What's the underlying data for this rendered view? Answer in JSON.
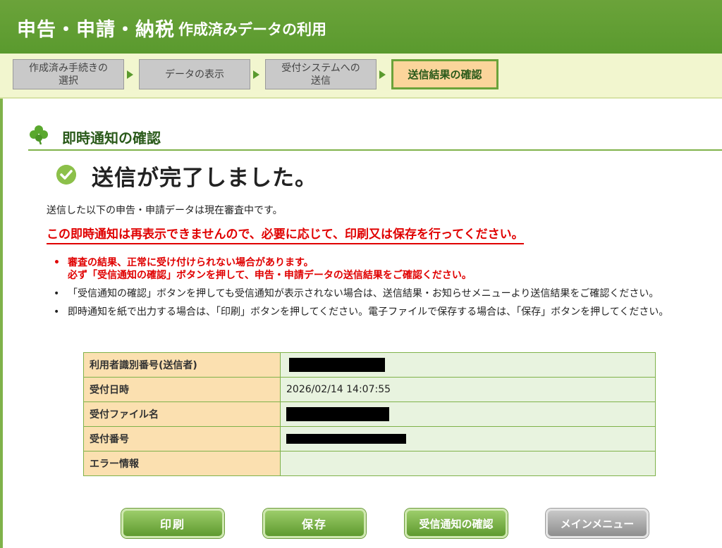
{
  "header": {
    "title": "申告・申請・納税",
    "subtitle": "作成済みデータの利用"
  },
  "steps": [
    {
      "label_line1": "作成済み手続きの",
      "label_line2": "選択",
      "active": false
    },
    {
      "label_line1": "データの表示",
      "label_line2": "",
      "active": false
    },
    {
      "label_line1": "受付システムへの",
      "label_line2": "送信",
      "active": false
    },
    {
      "label_line1": "送信結果の確認",
      "label_line2": "",
      "active": true
    }
  ],
  "section": {
    "title": "即時通知の確認"
  },
  "result": {
    "title": "送信が完了しました。",
    "description": "送信した以下の申告・申請データは現在審査中です。",
    "warning": "この即時通知は再表示できませんので、必要に応じて、印刷又は保存を行ってください。"
  },
  "notes": {
    "red_line1": "審査の結果、正常に受け付けられない場合があります。",
    "red_line2": "必ず「受信通知の確認」ボタンを押して、申告・申請データの送信結果をご確認ください。",
    "note2": "「受信通知の確認」ボタンを押しても受信通知が表示されない場合は、送信結果・お知らせメニューより送信結果をご確認ください。",
    "note3": "即時通知を紙で出力する場合は、「印刷」ボタンを押してください。電子ファイルで保存する場合は、「保存」ボタンを押してください。"
  },
  "info_table": {
    "rows": [
      {
        "label": "利用者識別番号(送信者)",
        "value": ""
      },
      {
        "label": "受付日時",
        "value": "2026/02/14 14:07:55"
      },
      {
        "label": "受付ファイル名",
        "value": ""
      },
      {
        "label": "受付番号",
        "value": ""
      },
      {
        "label": "エラー情報",
        "value": ""
      }
    ]
  },
  "buttons": {
    "print": "印刷",
    "save": "保存",
    "confirm_receipt": "受信通知の確認",
    "main_menu": "メインメニュー"
  },
  "colors": {
    "header_green": "#5a9a2e",
    "steps_bg": "#f2f6cf",
    "active_step": "#fbd59b",
    "warning_red": "#e00000",
    "table_label_bg": "#fbe0b0",
    "table_value_bg": "#e8f3df"
  },
  "icons": {
    "section": "clover-icon",
    "result": "checkmark-circle-icon",
    "step_separator": "triangle-right-icon"
  }
}
